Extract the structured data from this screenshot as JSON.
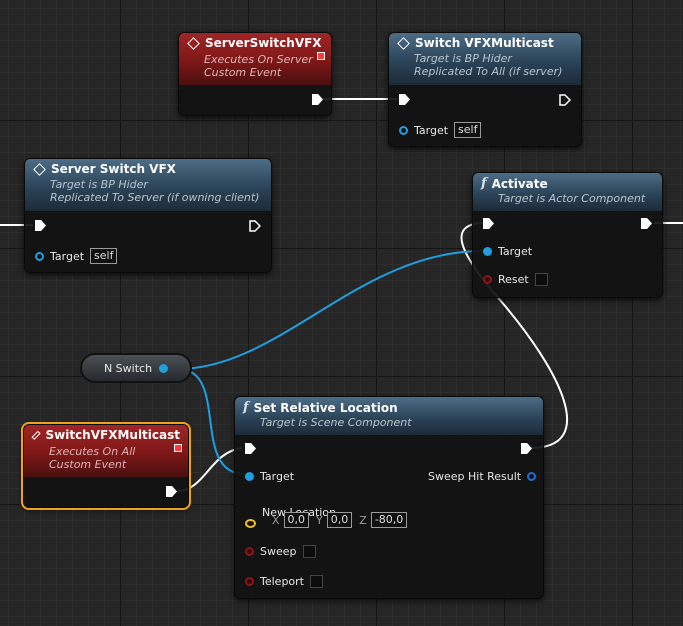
{
  "nodes": {
    "server_switch_vfx_event": {
      "title": "ServerSwitchVFX",
      "sub1": "Executes On Server",
      "sub2": "Custom Event"
    },
    "switch_vfx_multicast_call": {
      "title": "Switch VFXMulticast",
      "sub1": "Target is BP Hider",
      "sub2": "Replicated To All (if server)",
      "target_label": "Target",
      "target_value": "self"
    },
    "server_switch_vfx_call": {
      "title": "Server Switch VFX",
      "sub1": "Target is BP Hider",
      "sub2": "Replicated To Server (if owning client)",
      "target_label": "Target",
      "target_value": "self"
    },
    "activate": {
      "title": "Activate",
      "sub1": "Target is Actor Component",
      "target_label": "Target",
      "reset_label": "Reset"
    },
    "n_switch": {
      "label": "N Switch"
    },
    "switch_vfx_multicast_event": {
      "title": "SwitchVFXMulticast",
      "sub1": "Executes On All",
      "sub2": "Custom Event"
    },
    "set_relative_location": {
      "title": "Set Relative Location",
      "sub1": "Target is Scene Component",
      "target_label": "Target",
      "sweep_hit_label": "Sweep Hit Result",
      "new_location_label": "New Location",
      "x_label": "X",
      "x_value": "0,0",
      "y_label": "Y",
      "y_value": "0,0",
      "z_label": "Z",
      "z_value": "-80,0",
      "sweep_label": "Sweep",
      "teleport_label": "Teleport"
    }
  },
  "icons": {
    "event": "diamond-event-icon",
    "function": "function-icon",
    "delegate": "delegate-pin-icon"
  },
  "colors": {
    "event_header": "#8a1c1c",
    "function_header": "#3b5a72",
    "object_pin": "#1f9fe0",
    "bool_pin": "#8e1616",
    "vector_pin": "#f0c02a",
    "exec_wire": "#ffffff",
    "selected_outline": "#f0a21a"
  }
}
